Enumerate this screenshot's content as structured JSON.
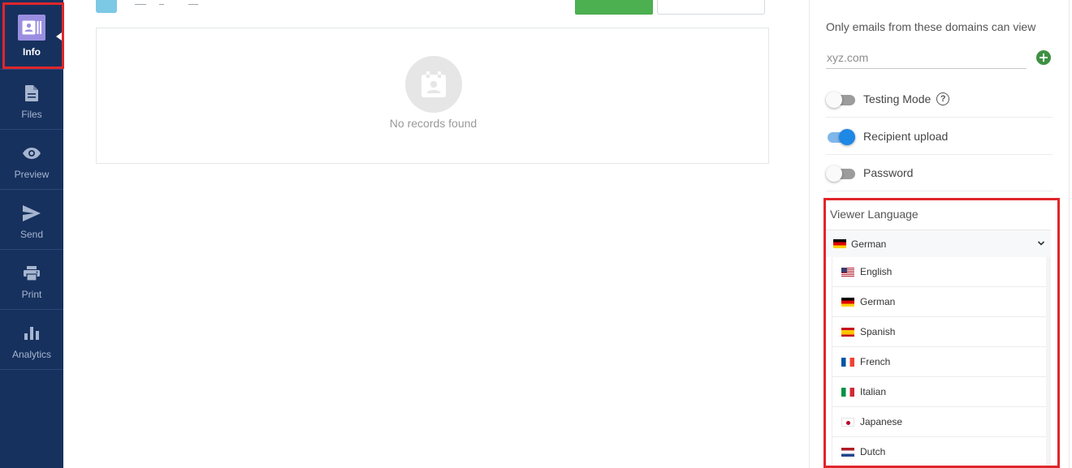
{
  "sidebar": {
    "items": [
      {
        "label": "Info",
        "icon": "info-card-icon",
        "active": true
      },
      {
        "label": "Files",
        "icon": "file-icon"
      },
      {
        "label": "Preview",
        "icon": "eye-icon"
      },
      {
        "label": "Send",
        "icon": "send-icon"
      },
      {
        "label": "Print",
        "icon": "printer-icon"
      },
      {
        "label": "Analytics",
        "icon": "bar-chart-icon"
      }
    ]
  },
  "main": {
    "empty_state": {
      "icon": "calendar-contact-icon",
      "text": "No records found"
    }
  },
  "settings": {
    "domains_label": "Only emails from these domains can view",
    "domain_placeholder": "xyz.com",
    "add_icon": "plus-circle-icon",
    "toggles": [
      {
        "label": "Testing Mode",
        "on": false,
        "help_icon": "question-circle-icon"
      },
      {
        "label": "Recipient upload",
        "on": true
      },
      {
        "label": "Password",
        "on": false
      }
    ],
    "viewer_language": {
      "title": "Viewer Language",
      "selected": {
        "label": "German",
        "flag": "flag-de"
      },
      "options": [
        {
          "label": "English",
          "flag": "flag-us"
        },
        {
          "label": "German",
          "flag": "flag-de"
        },
        {
          "label": "Spanish",
          "flag": "flag-es"
        },
        {
          "label": "French",
          "flag": "flag-fr"
        },
        {
          "label": "Italian",
          "flag": "flag-it"
        },
        {
          "label": "Japanese",
          "flag": "flag-jp"
        },
        {
          "label": "Dutch",
          "flag": "flag-nl"
        }
      ]
    }
  },
  "colors": {
    "sidebar_bg": "#17315e",
    "highlight_red": "#e0262b",
    "primary_blue": "#1e88e5",
    "success_green": "#4caf50"
  }
}
